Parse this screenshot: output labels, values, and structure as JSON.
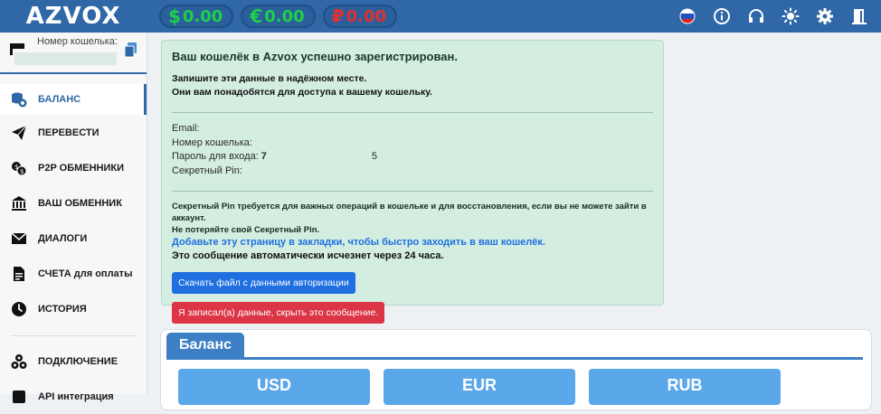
{
  "app": {
    "logo": "AZVOX"
  },
  "balances": [
    {
      "symbol": "$",
      "value": "0.00",
      "color": "#1fcf48"
    },
    {
      "symbol": "€",
      "value": "0.00",
      "color": "#1fcf48"
    },
    {
      "symbol": "₽",
      "value": "0.00",
      "color": "#e03030"
    }
  ],
  "top_icons": [
    "russia-flag-icon",
    "info-icon",
    "headset-icon",
    "sun-icon",
    "gear-icon",
    "logout-door-icon"
  ],
  "sidebar": {
    "wallet_label": "Номер кошелька:",
    "items": [
      {
        "label": "БАЛАНС",
        "icon": "coins-icon"
      },
      {
        "label": "ПЕРЕВЕСТИ",
        "icon": "paper-plane-icon"
      },
      {
        "label": "P2P ОБМЕННИКИ",
        "icon": "exchange-coins-icon"
      },
      {
        "label": "ВАШ ОБМЕННИК",
        "icon": "bank-icon"
      },
      {
        "label": "ДИАЛОГИ",
        "icon": "envelope-icon"
      },
      {
        "label": "СЧЕТА для оплаты",
        "icon": "invoice-icon"
      },
      {
        "label": "ИСТОРИЯ",
        "icon": "clock-icon"
      }
    ],
    "extra_items": [
      {
        "label": "ПОДКЛЮЧЕНИЕ",
        "icon": "cubes-icon"
      },
      {
        "label": "API интеграция",
        "icon": "api-icon"
      }
    ]
  },
  "alert": {
    "title": "Ваш кошелёк в Azvox успешно зарегистрирован.",
    "instruction_line1": "Запишите эти данные в надёжном месте.",
    "instruction_line2": "Они вам понадобятся для доступа к вашему кошельку.",
    "email_label": "Email:",
    "wallet_label": "Номер кошелька:",
    "password_label": "Пароль для входа:",
    "password_start": "7",
    "password_end": "5",
    "pin_label": "Секретный Pin:",
    "pin_note_line1": "Секретный Pin требуется для важных операций в кошельке и для восстановления, если вы не можете зайти в аккаунт.",
    "pin_note_line2": "Не потеряйте свой Секретный Pin.",
    "bookmark_text": "Добавьте эту страницу в закладки, чтобы быстро заходить в ваш кошелёк.",
    "autodelete_text": "Это сообщение автоматически исчезнет через 24 часа.",
    "download_button": "Скачать файл с данными авторизации",
    "hide_button": "Я записал(а) данные, скрыть это сообщение."
  },
  "balance_panel": {
    "tab_label": "Баланс",
    "currencies": [
      "USD",
      "EUR",
      "RUB"
    ]
  },
  "colors": {
    "primary": "#2f67a7",
    "success_bg": "#d4ede1",
    "danger": "#dc3545",
    "link": "#1f6fe0"
  }
}
